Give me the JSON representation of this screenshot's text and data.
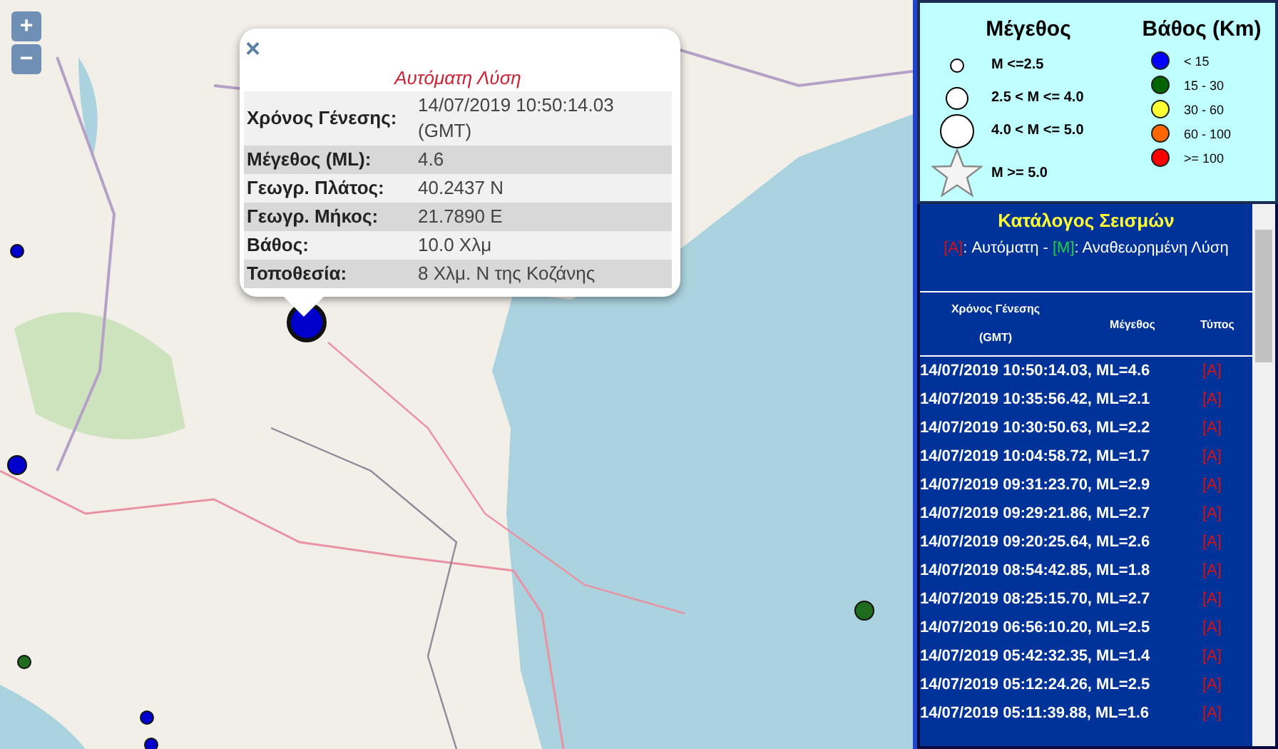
{
  "zoom_controls": [
    {
      "label": "+"
    },
    {
      "label": "−"
    }
  ],
  "markers": [
    {
      "color": "#0000cc",
      "kind": "small"
    },
    {
      "color": "#0000cc",
      "kind": "large"
    },
    {
      "color": "#0000cc",
      "kind": "medium"
    },
    {
      "color": "#1f6b1f",
      "kind": "medium"
    },
    {
      "color": "#1f6b1f",
      "kind": "small"
    },
    {
      "color": "#0000cc",
      "kind": "small"
    },
    {
      "color": "#0000cc",
      "kind": "small"
    }
  ],
  "popup": {
    "close": "×",
    "title": "Αυτόματη Λύση",
    "rows": [
      {
        "label": "Χρόνος Γένεσης:",
        "value": "14/07/2019 10:50:14.03 (GMT)"
      },
      {
        "label": "Μέγεθος (ML):",
        "value": "4.6"
      },
      {
        "label": "Γεωγρ. Πλάτος:",
        "value": "40.2437 N"
      },
      {
        "label": "Γεωγρ. Μήκος:",
        "value": "21.7890 E"
      },
      {
        "label": "Βάθος:",
        "value": "10.0 Χλμ"
      },
      {
        "label": "Τοποθεσία:",
        "value": "8 Χλμ. Ν της Κοζάνης"
      }
    ]
  },
  "legend": {
    "magnitude_title": "Μέγεθος",
    "magnitude_items": [
      {
        "kind": "small",
        "label": "M <=2.5"
      },
      {
        "kind": "medium",
        "label": "2.5 < M <= 4.0"
      },
      {
        "kind": "large",
        "label": "4.0 < M <= 5.0"
      },
      {
        "kind": "star",
        "label": "M >= 5.0"
      }
    ],
    "depth_title": "Βάθος (Km)",
    "depth_items": [
      {
        "color": "#0000ff",
        "label": "< 15"
      },
      {
        "color": "#006400",
        "label": "15 - 30"
      },
      {
        "color": "#ffff33",
        "label": "30 - 60"
      },
      {
        "color": "#ff6600",
        "label": "60 - 100"
      },
      {
        "color": "#ff0000",
        "label": ">= 100"
      }
    ]
  },
  "catalog": {
    "title": "Κατάλογος Σεισμών",
    "note": [
      {
        "kind": "auto",
        "text": "[A]"
      },
      {
        "kind": "plain",
        "text": ": Αυτόματη - "
      },
      {
        "kind": "manual",
        "text": "[M]"
      },
      {
        "kind": "plain",
        "text": ": Αναθεωρημένη Λύση"
      }
    ],
    "columns": [
      "Χρόνος Γένεσης (GMT)",
      "Μέγεθος",
      "Τύπος"
    ],
    "rows": [
      {
        "event": "14/07/2019 10:50:14.03, ML=4.6",
        "type": "[A]"
      },
      {
        "event": "14/07/2019 10:35:56.42, ML=2.1",
        "type": "[A]"
      },
      {
        "event": "14/07/2019 10:30:50.63, ML=2.2",
        "type": "[A]"
      },
      {
        "event": "14/07/2019 10:04:58.72, ML=1.7",
        "type": "[A]"
      },
      {
        "event": "14/07/2019 09:31:23.70, ML=2.9",
        "type": "[A]"
      },
      {
        "event": "14/07/2019 09:29:21.86, ML=2.7",
        "type": "[A]"
      },
      {
        "event": "14/07/2019 09:20:25.64, ML=2.6",
        "type": "[A]"
      },
      {
        "event": "14/07/2019 08:54:42.85, ML=1.8",
        "type": "[A]"
      },
      {
        "event": "14/07/2019 08:25:15.70, ML=2.7",
        "type": "[A]"
      },
      {
        "event": "14/07/2019 06:56:10.20, ML=2.5",
        "type": "[A]"
      },
      {
        "event": "14/07/2019 05:42:32.35, ML=1.4",
        "type": "[A]"
      },
      {
        "event": "14/07/2019 05:12:24.26, ML=2.5",
        "type": "[A]"
      },
      {
        "event": "14/07/2019 05:11:39.88, ML=1.6",
        "type": "[A]"
      }
    ]
  }
}
